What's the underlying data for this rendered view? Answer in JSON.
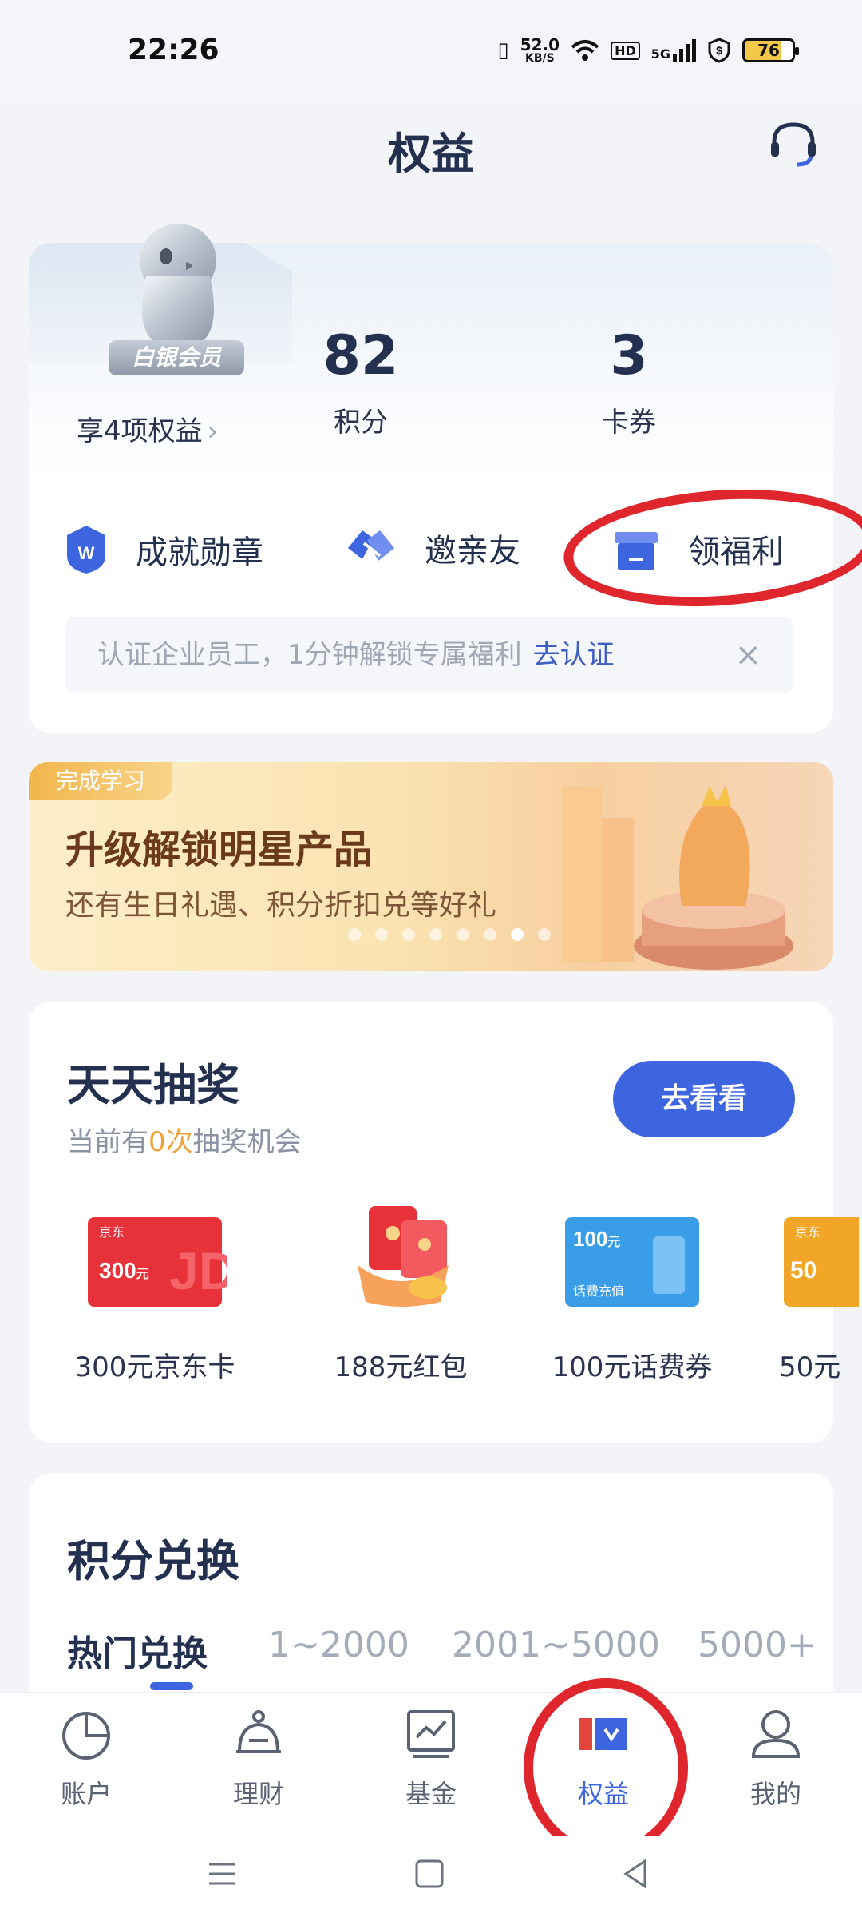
{
  "status_bar": {
    "time": "22:26",
    "net_speed_value": "52.0",
    "net_speed_unit": "KB/S",
    "hd": "HD",
    "network": "5G",
    "battery": "76"
  },
  "header": {
    "title": "权益"
  },
  "member": {
    "level": "白银会员",
    "benefits_link": "享4项权益",
    "points_value": "82",
    "points_label": "积分",
    "coupons_value": "3",
    "coupons_label": "卡券"
  },
  "quick_actions": [
    {
      "label": "成就勋章",
      "icon": "medal-icon"
    },
    {
      "label": "邀亲友",
      "icon": "handshake-icon"
    },
    {
      "label": "领福利",
      "icon": "gift-icon"
    }
  ],
  "cert_bar": {
    "text": "认证企业员工，1分钟解锁专属福利",
    "action": "去认证",
    "close": "×"
  },
  "banner": {
    "tag": "完成学习",
    "title": "升级解锁明星产品",
    "subtitle": "还有生日礼遇、积分折扣兑等好礼",
    "page_count": 8,
    "active_page": 7
  },
  "lottery": {
    "title": "天天抽奖",
    "subtitle_prefix": "当前有",
    "subtitle_count": "0次",
    "subtitle_suffix": "抽奖机会",
    "button": "去看看",
    "prizes": [
      {
        "label": "300元京东卡",
        "card_brand": "京东",
        "card_value": "300",
        "card_unit": "元",
        "card_logo": "JD"
      },
      {
        "label": "188元红包"
      },
      {
        "label": "100元话费券",
        "card_value": "100",
        "card_unit": "元",
        "card_sub": "话费充值"
      },
      {
        "label": "50元",
        "card_brand": "京东",
        "card_value": "50"
      }
    ]
  },
  "points_exchange": {
    "title": "积分兑换",
    "tabs": [
      "热门兑换",
      "1~2000",
      "2001~5000",
      "5000+"
    ],
    "active_tab": 0
  },
  "bottom_nav": [
    {
      "label": "账户",
      "icon": "pie-chart-icon"
    },
    {
      "label": "理财",
      "icon": "money-bag-icon"
    },
    {
      "label": "基金",
      "icon": "fund-chart-icon"
    },
    {
      "label": "权益",
      "icon": "rights-icon",
      "active": true
    },
    {
      "label": "我的",
      "icon": "user-icon"
    }
  ],
  "colors": {
    "accent": "#3e65e0",
    "title": "#23304f",
    "annotation": "#e0262d",
    "highlight": "#f0a33a"
  }
}
